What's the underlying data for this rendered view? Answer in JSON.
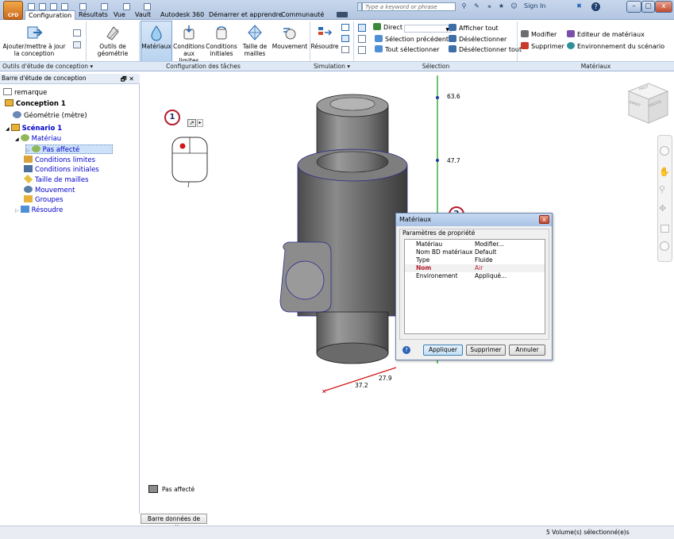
{
  "app": {
    "logo_text": "CFD",
    "tabs": [
      "Configuration",
      "Résultats",
      "Vue",
      "Vault",
      "Autodesk 360",
      "Démarrer et apprendre",
      "Communauté"
    ],
    "search_placeholder": "Type a keyword or phrase",
    "sign_in": "Sign In",
    "window_buttons": [
      "–",
      "▢",
      "x"
    ]
  },
  "ribbon": {
    "buttons": {
      "add_update": "Ajouter/mettre à jour la conception",
      "geometry_tools": "Outils de géométrie",
      "materials": "Matériaux",
      "boundary_conditions": "Conditions aux limites",
      "initial_conditions": "Conditions initiales",
      "mesh_size": "Taille de mailles",
      "motion": "Mouvement",
      "solve": "Résoudre"
    },
    "selection": {
      "mode": "Direct",
      "previous": "Sélection précédente",
      "select_all": "Tout sélectionner",
      "show_all": "Afficher tout",
      "deselect": "Désélectionner",
      "deselect_all": "Désélectionner tout"
    },
    "materials": {
      "edit": "Modifier",
      "delete": "Supprimer",
      "material_editor": "Editeur de matériaux",
      "scenario_env": "Environnement du scénario"
    },
    "groups": {
      "design_tools": "Outils d'étude de conception ▾",
      "task_setup": "Configuration des tâches",
      "simulation": "Simulation ▾",
      "selection": "Sélection",
      "materials": "Matériaux"
    }
  },
  "panel": {
    "title": "Barre d'étude de conception",
    "pin": "🗗 ✕",
    "items": [
      {
        "label": "remarque"
      },
      {
        "label": "Conception 1"
      },
      {
        "label": "Géométrie (mètre)"
      },
      {
        "label": "Scénario 1"
      },
      {
        "label": "Matériau"
      },
      {
        "label": "Pas affecté"
      },
      {
        "label": "Conditions limites"
      },
      {
        "label": "Conditions initiales"
      },
      {
        "label": "Taille de mailles"
      },
      {
        "label": "Mouvement"
      },
      {
        "label": "Groupes"
      },
      {
        "label": "Résoudre"
      }
    ]
  },
  "viewport": {
    "axis_labels": [
      "63.6",
      "47.7",
      "27.9",
      "37.2"
    ],
    "viewcube": {
      "top": "HAUT",
      "front": "AVANT",
      "right": "DROITE"
    },
    "callouts": [
      "1",
      "2"
    ],
    "legend": "Pas affecté",
    "output_bar": "Barre données de sortie"
  },
  "dialog": {
    "title": "Matériaux",
    "group_label": "Paramètres de propriété",
    "rows": [
      {
        "key": "Matériau",
        "value": "Modifier..."
      },
      {
        "key": "Nom BD matériaux",
        "value": "Default"
      },
      {
        "key": "Type",
        "value": "Fluide"
      },
      {
        "key": "Nom",
        "value": "Air"
      },
      {
        "key": "Environement",
        "value": "Appliqué..."
      }
    ],
    "buttons": {
      "apply": "Appliquer",
      "delete": "Supprimer",
      "cancel": "Annuler"
    },
    "help": "?"
  },
  "status": {
    "text": "5 Volume(s) sélectionné(e)s"
  },
  "colors": {
    "accent_red": "#b41e2e",
    "y_axis": "#1ea51e",
    "x_axis": "#d41818",
    "tree_link": "#0000cc"
  }
}
